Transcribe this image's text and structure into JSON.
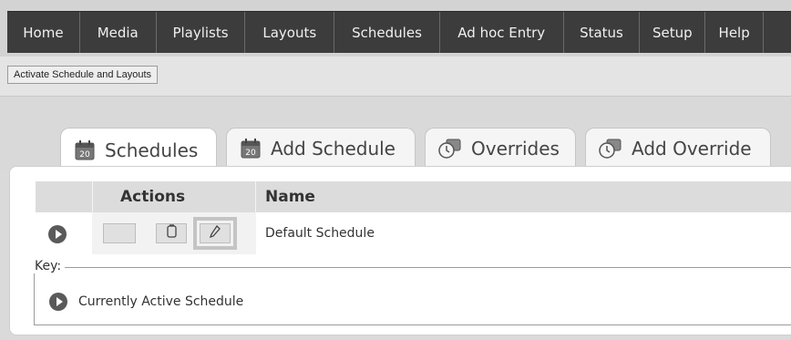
{
  "nav": {
    "items": [
      {
        "label": "Home"
      },
      {
        "label": "Media"
      },
      {
        "label": "Playlists"
      },
      {
        "label": "Layouts"
      },
      {
        "label": "Schedules"
      },
      {
        "label": "Ad hoc Entry"
      },
      {
        "label": "Status"
      },
      {
        "label": "Setup"
      },
      {
        "label": "Help"
      },
      {
        "label": ""
      }
    ]
  },
  "toolbar": {
    "activate_label": "Activate Schedule and Layouts"
  },
  "tabs": [
    {
      "label": "Schedules",
      "icon": "calendar-icon",
      "active": true
    },
    {
      "label": "Add Schedule",
      "icon": "calendar-icon",
      "active": false
    },
    {
      "label": "Overrides",
      "icon": "override-icon",
      "active": false
    },
    {
      "label": "Add Override",
      "icon": "override-icon",
      "active": false
    }
  ],
  "table": {
    "columns": {
      "actions": "Actions",
      "name": "Name"
    },
    "rows": [
      {
        "name": "Default Schedule",
        "active": true
      }
    ]
  },
  "key": {
    "legend": "Key:",
    "items": [
      {
        "label": "Currently Active Schedule",
        "icon": "play-circle-icon"
      }
    ]
  },
  "colors": {
    "navbar": "#3c3c3c",
    "tab_active": "#ffffff",
    "header": "#dcdcdc"
  }
}
